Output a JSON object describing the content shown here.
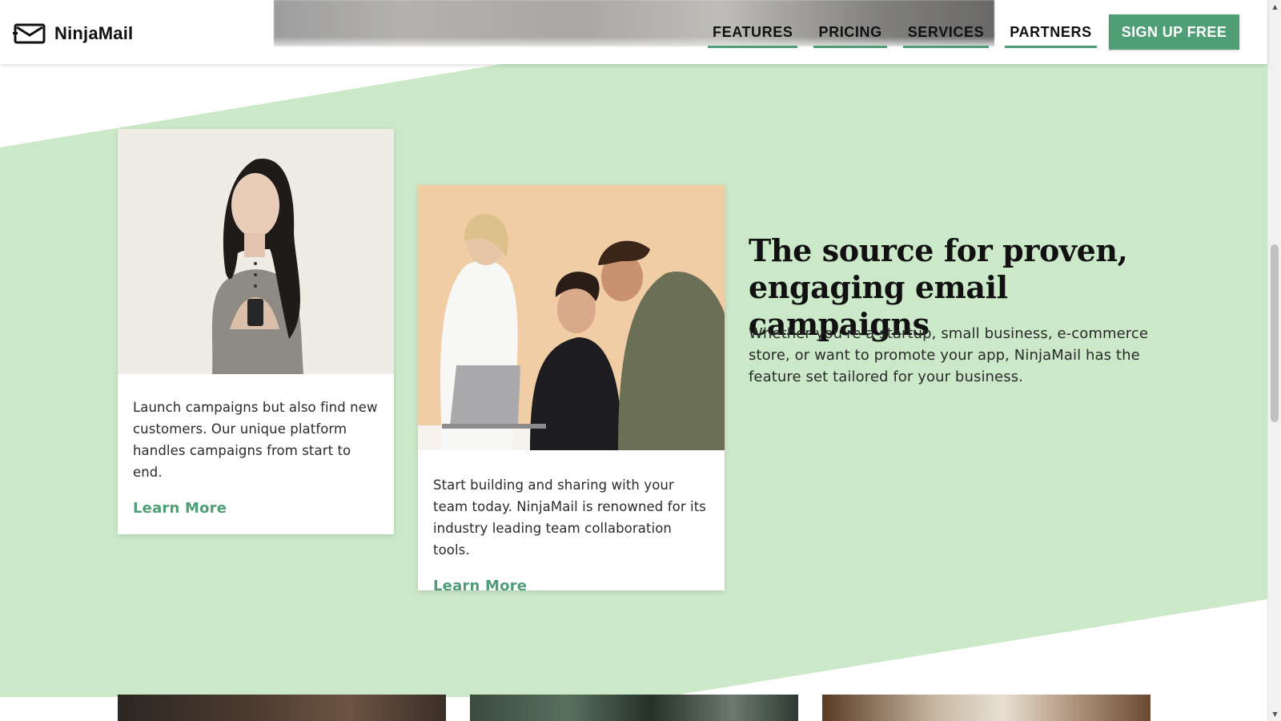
{
  "colors": {
    "accent": "#4f9e76",
    "band_green": "#cbe8c8",
    "text_dark": "#111111"
  },
  "header": {
    "logo_icon": "envelope-icon",
    "logo_text": "NinjaMail",
    "nav": [
      {
        "label": "FEATURES"
      },
      {
        "label": "PRICING"
      },
      {
        "label": "SERVICES"
      },
      {
        "label": "PARTNERS"
      }
    ],
    "signup_label": "SIGN UP FREE"
  },
  "cards": [
    {
      "text": "Launch campaigns but also find new customers. Our unique platform handles campaigns from start to end.",
      "link": "Learn More"
    },
    {
      "text": "Start building and sharing with your team today. NinjaMail is renowned for its industry leading team collaboration tools.",
      "link": "Learn More"
    }
  ],
  "section": {
    "headline": "The source for proven, engaging email campaigns",
    "lead": "Whether you're a startup, small business, e-commerce store, or want to promote your app, NinjaMail has the feature set tailored for your business."
  }
}
